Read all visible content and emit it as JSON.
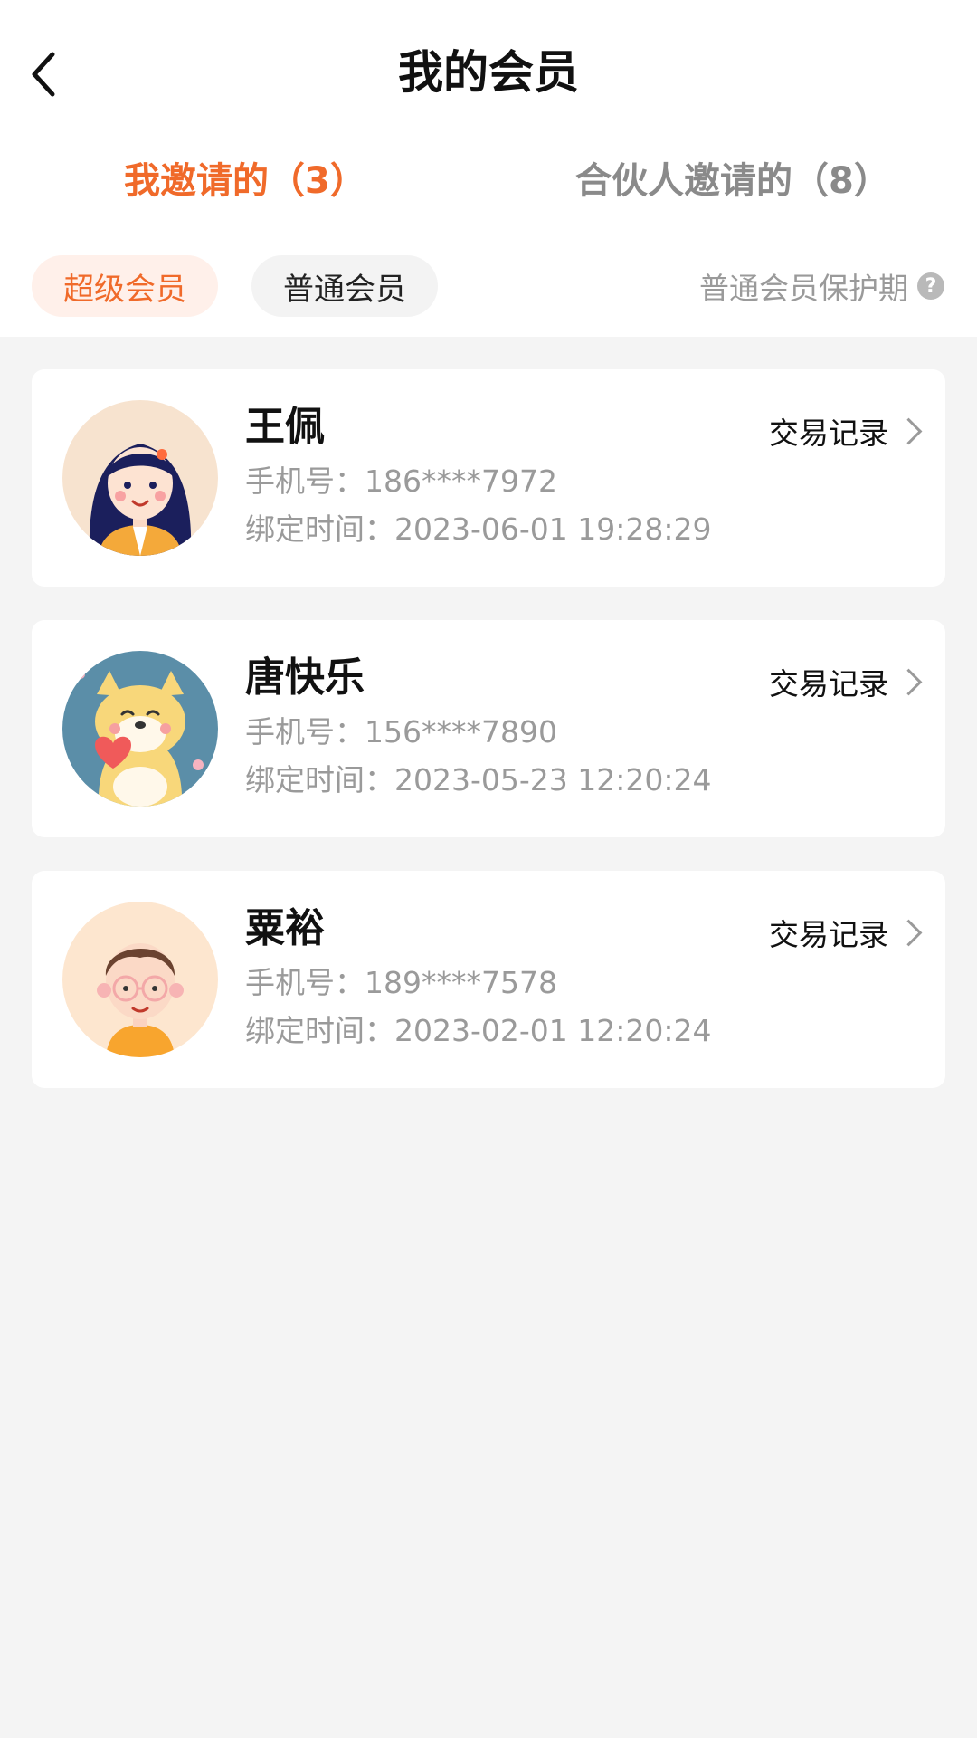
{
  "header": {
    "title": "我的会员",
    "back_icon": "back-arrow-icon"
  },
  "tabs": [
    {
      "label": "我邀请的（3）",
      "active": true
    },
    {
      "label": "合伙人邀请的（8）",
      "active": false
    }
  ],
  "filters": [
    {
      "label": "超级会员",
      "selected": true
    },
    {
      "label": "普通会员",
      "selected": false
    }
  ],
  "protection": {
    "label": "普通会员保护期",
    "icon": "question-help-icon",
    "icon_glyph": "?"
  },
  "colors": {
    "accent": "#f06a2a",
    "background": "#f4f4f4",
    "text_secondary": "#9a9a9a"
  },
  "members": [
    {
      "name": "王佩",
      "phone": "手机号：186****7972",
      "bind_time": "绑定时间：2023-06-01 19:28:29",
      "action": "交易记录",
      "avatar": "girl-avatar"
    },
    {
      "name": "唐快乐",
      "phone": "手机号：156****7890",
      "bind_time": "绑定时间：2023-05-23 12:20:24",
      "action": "交易记录",
      "avatar": "shiba-dog-avatar"
    },
    {
      "name": "粟裕",
      "phone": "手机号：189****7578",
      "bind_time": "绑定时间：2023-02-01 12:20:24",
      "action": "交易记录",
      "avatar": "boy-glasses-avatar"
    }
  ]
}
